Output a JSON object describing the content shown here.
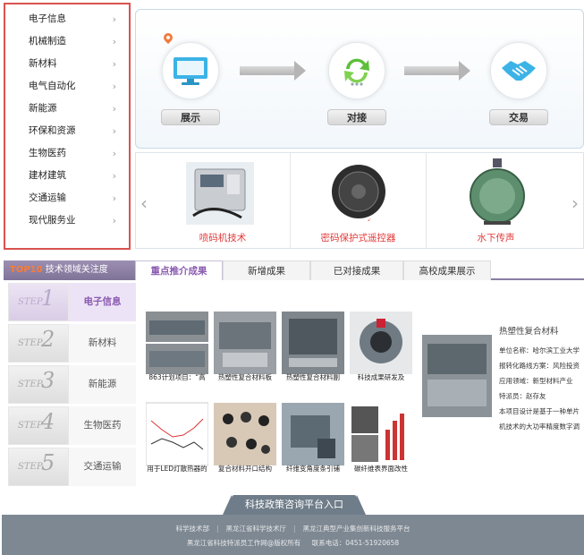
{
  "sidebar": {
    "items": [
      {
        "label": "电子信息"
      },
      {
        "label": "机械制造"
      },
      {
        "label": "新材料"
      },
      {
        "label": "电气自动化"
      },
      {
        "label": "新能源"
      },
      {
        "label": "环保和资源"
      },
      {
        "label": "生物医药"
      },
      {
        "label": "建材建筑"
      },
      {
        "label": "交通运输"
      },
      {
        "label": "现代服务业"
      }
    ],
    "chevron": "›"
  },
  "process": {
    "steps": [
      {
        "label": "展示",
        "icon": "monitor-icon"
      },
      {
        "label": "对接",
        "icon": "recycle-arrows-icon"
      },
      {
        "label": "交易",
        "icon": "handshake-icon"
      }
    ]
  },
  "carousel": {
    "prev": "‹",
    "next": "›",
    "items": [
      {
        "caption": "喷码机技术"
      },
      {
        "caption": "密码保护式遥控器"
      },
      {
        "caption": "水下传声"
      }
    ]
  },
  "achievements": {
    "header_top10": "TOP10",
    "header_title": "技术领域关注度",
    "tabs": [
      "重点推介成果",
      "新增成果",
      "已对接成果",
      "高校成果展示"
    ],
    "step_word": "STEP",
    "steps": [
      {
        "num": "1",
        "label": "电子信息"
      },
      {
        "num": "2",
        "label": "新材料"
      },
      {
        "num": "3",
        "label": "新能源"
      },
      {
        "num": "4",
        "label": "生物医药"
      },
      {
        "num": "5",
        "label": "交通运输"
      }
    ],
    "grid": [
      {
        "caption": "863计划项目：“高"
      },
      {
        "caption": "热塑性复合材料板"
      },
      {
        "caption": "热塑性复合材料副"
      },
      {
        "caption": "科技成果研发及"
      },
      {
        "caption": "用于LED灯散热器的"
      },
      {
        "caption": "复合材料开口结构"
      },
      {
        "caption": "纤维变角度条引铺"
      },
      {
        "caption": "碳纤维表界面改性"
      }
    ],
    "detail": {
      "title": "热塑性复合材料",
      "lines": [
        "单位名称：哈尔滨工业大学",
        "报转化路线方案：风险投资",
        "应用领域：新型材料产业",
        "特派员：赵存友",
        "本项目设计是基于一种单片",
        "机技术的大功率精度数字调"
      ]
    }
  },
  "footer": {
    "tab_label": "科技政策咨询平台入口",
    "links": [
      "科学技术部",
      "黑龙江省科学技术厅",
      "黑龙江典型产业集创新科技服务平台"
    ],
    "copyright": "黑龙江省科技特派员工作网@版权所有",
    "phone": "联系电话：0451-51920658",
    "colors": {
      "bar": "#7d8893",
      "accent": "#8a5ab0",
      "alert": "#e23b3b"
    }
  }
}
